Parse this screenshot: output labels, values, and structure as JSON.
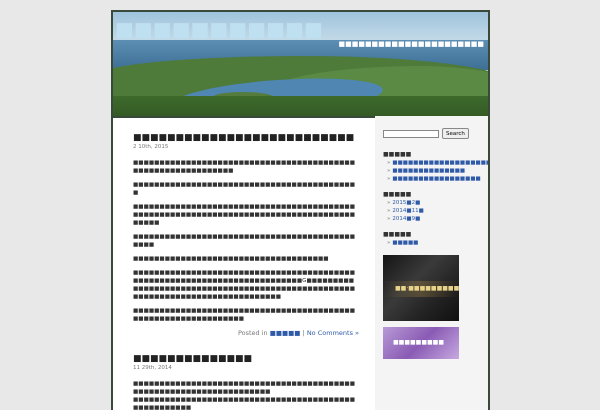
{
  "header": {
    "blog_title": "■■■■■■■■■■■",
    "blog_description": "■■■■■■■■■■■■■■■■■■■■■■"
  },
  "posts": [
    {
      "title": "■■■■■■■■■■■■■■■■■■■■■■■■■■",
      "date": "2  10th, 2015",
      "paragraphs": [
        "■■■■■■■■■■■■■■■■■■■■■■■■■■■■■■■■■■■■■■■■■■■■■■■■■■■■■■■■■■■■■",
        "■■■■■■■■■■■■■■■■■■■■■■■■■■■■■■■■■■■■■■■■■■■",
        "■■■■■■■■■■■■■■■■■■■■■■■■■■■■■■■■■■■■■■■■■■■■■■■■■■■■■■■■■■■■■■■■■■■■■■■■■■■■■■■■■■■■■■■■■",
        "■■■■■■■■■■■■■■■■■■■■■■■■■■■■■■■■■■■■■■■■■■■■■■",
        "■■■■■■■■■■■■■■■■■■■■■■■■■■■■■■■■■■■■■",
        "■■■■■■■■■■■■■■■■■■■■■■■■■■■■■■■■■■■■■■■■■■■■■■■■■■■■■■■■■■■■■■■■■■■■■■■■■■G■■■■■■■■■■■■■■■■■■■■■■■■■■■■■■■■■■■■■■■■■■■■■■■■■■■■■■■■■■■■■■■■■■■■■■■■■■■■■■■",
        "■■■■■■■■■■■■■■■■■■■■■■■■■■■■■■■■■■■■■■■■■■■■■■■■■■■■■■■■■■■■■■■"
      ],
      "posted_in_label": "Posted in",
      "category": "■■■■■",
      "comments": "No Comments »"
    },
    {
      "title": "■■■■■■■■■■■■■■",
      "date": "11  29th, 2014",
      "paragraphs": [
        "■■■■■■■■■■■■■■■■■■■■■■■■■■■■■■■■■■■■■■■■■■■■■■■■■■■■■■■■■■■■■■■■■■■■",
        "■■■■■■■■■■■■■■■■■■■■■■■■■■■■■■■■■■■■■■■■■■■■■■■■■■■■■"
      ]
    }
  ],
  "sidebar": {
    "search_button": "Search",
    "search_value": "",
    "recent_title": "■■■■■",
    "recent_posts": [
      "■■■■■■■■■■■■■■■■■■■■■■■■■■",
      "■■■■■■■■■■■■■■",
      "■■■■■■■■■■■■■■■■■"
    ],
    "archives_title": "■■■■■",
    "archives": [
      "2015■2■",
      "2014■11■",
      "2014■9■"
    ],
    "categories_title": "■■■■■",
    "categories": [
      "■■■■■"
    ],
    "banner1_text": "■■·■■■■■■■■■",
    "banner2_text": "■■■■■■■■■"
  }
}
